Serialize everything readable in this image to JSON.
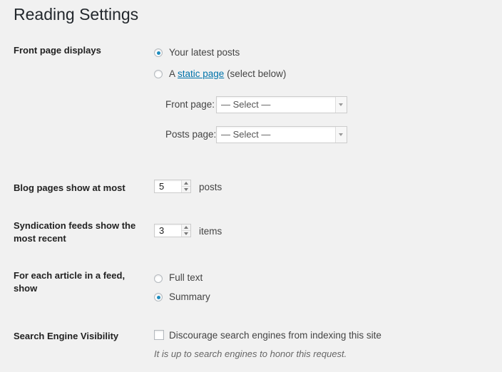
{
  "page_title": "Reading Settings",
  "front_page": {
    "label": "Front page displays",
    "options": [
      {
        "label": "Your latest posts",
        "selected": true
      },
      {
        "prefix": "A ",
        "link": "static page",
        "suffix": " (select below)",
        "selected": false
      }
    ],
    "front_page_label": "Front page:",
    "front_page_value": "— Select —",
    "posts_page_label": "Posts page:",
    "posts_page_value": "— Select —"
  },
  "blog_pages": {
    "label": "Blog pages show at most",
    "value": "5",
    "unit": "posts"
  },
  "syndication": {
    "label": "Syndication feeds show the most recent",
    "value": "3",
    "unit": "items"
  },
  "feed_article": {
    "label": "For each article in a feed, show",
    "options": [
      {
        "label": "Full text",
        "selected": false
      },
      {
        "label": "Summary",
        "selected": true
      }
    ]
  },
  "search_visibility": {
    "label": "Search Engine Visibility",
    "checkbox_label": "Discourage search engines from indexing this site",
    "checked": false,
    "description": "It is up to search engines to honor this request."
  }
}
